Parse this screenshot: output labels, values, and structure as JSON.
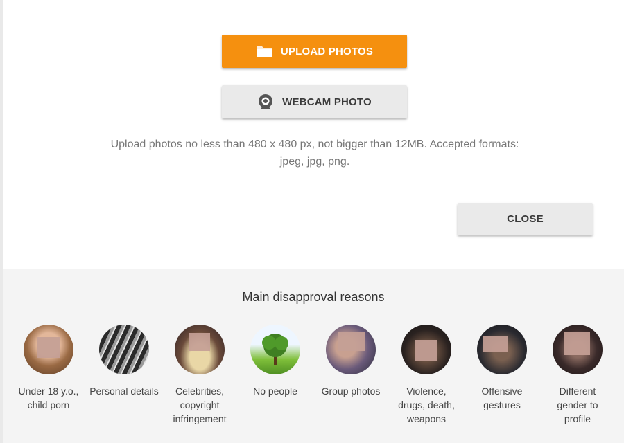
{
  "dialog": {
    "upload_label": "UPLOAD PHOTOS",
    "webcam_label": "WEBCAM PHOTO",
    "hint": "Upload photos no less than 480 x 480 px, not bigger than 12MB. Accepted formats: jpeg, jpg, png.",
    "close_label": "CLOSE"
  },
  "icons": {
    "upload": "folder-icon",
    "webcam": "webcam-icon"
  },
  "colors": {
    "accent": "#f5900f"
  },
  "reasons": {
    "title": "Main disapproval reasons",
    "items": [
      {
        "label": "Under 18 y.o., child porn"
      },
      {
        "label": "Personal details"
      },
      {
        "label": "Celebrities, copyright infringement"
      },
      {
        "label": "No people"
      },
      {
        "label": "Group photos"
      },
      {
        "label": "Violence, drugs, death, weapons"
      },
      {
        "label": "Offensive gestures"
      },
      {
        "label": "Different gender to profile"
      }
    ]
  }
}
